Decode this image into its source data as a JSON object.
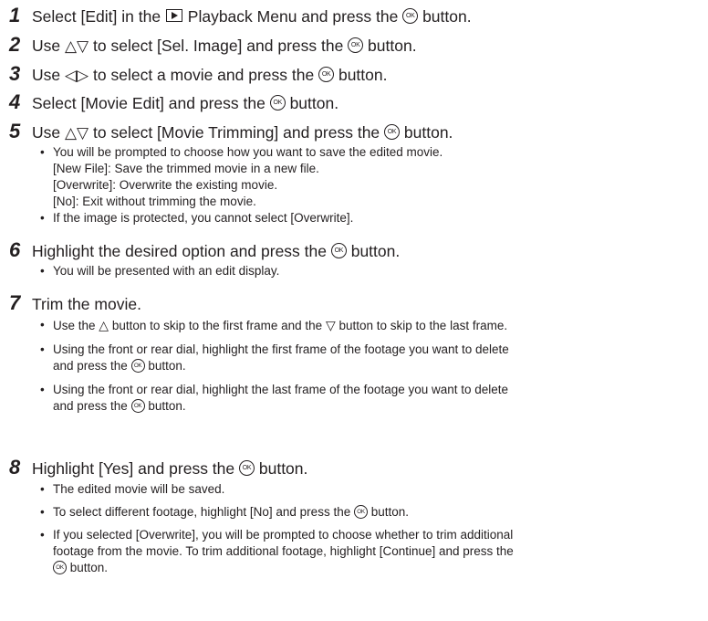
{
  "steps": [
    {
      "num": "1",
      "parts": [
        "Select [Edit] in the ",
        " Playback Menu and press the ",
        " button."
      ],
      "icons": [
        "playback-icon",
        "ok-button-icon"
      ]
    },
    {
      "num": "2",
      "parts": [
        "Use ",
        " to select [Sel. Image] and press the ",
        " button."
      ],
      "arrows": "△▽",
      "icons": [
        "ok-button-icon"
      ]
    },
    {
      "num": "3",
      "parts": [
        "Use ",
        " to select a movie and press the ",
        " button."
      ],
      "arrows": "◁▷",
      "icons": [
        "ok-button-icon"
      ]
    },
    {
      "num": "4",
      "parts": [
        "Select [Movie Edit] and press the ",
        " button."
      ],
      "icons": [
        "ok-button-icon"
      ]
    },
    {
      "num": "5",
      "parts": [
        "Use ",
        " to select [Movie Trimming] and press the ",
        " button."
      ],
      "arrows": "△▽",
      "icons": [
        "ok-button-icon"
      ],
      "bullets": [
        {
          "lines": [
            "You will be prompted to choose how you want to save the edited movie.",
            "[New File]: Save the trimmed movie in a new file.",
            "[Overwrite]: Overwrite the existing movie.",
            "[No]: Exit without trimming the movie."
          ]
        },
        {
          "lines": [
            "If the image is protected, you cannot select [Overwrite]."
          ]
        }
      ]
    },
    {
      "num": "6",
      "parts": [
        "Highlight the desired option and press the ",
        " button."
      ],
      "icons": [
        "ok-button-icon"
      ],
      "bullets": [
        {
          "lines": [
            "You will be presented with an edit display."
          ]
        }
      ]
    },
    {
      "num": "7",
      "parts": [
        "Trim the movie."
      ],
      "bullets": [
        {
          "parts": [
            "Use the ",
            " button to skip to the first frame and the ",
            " button to skip to the last frame."
          ],
          "up_arrow": "△",
          "down_arrow": "▽"
        },
        {
          "line1": "Using the front or rear dial, highlight the first frame of the footage you want to delete",
          "line2_parts": [
            "and press the ",
            " button."
          ]
        },
        {
          "line1": "Using the front or rear dial, highlight the last frame of the footage you want to delete",
          "line2_parts": [
            "and press the ",
            " button."
          ]
        }
      ]
    },
    {
      "num": "8",
      "parts": [
        "Highlight [Yes] and press the ",
        " button."
      ],
      "icons": [
        "ok-button-icon"
      ],
      "bullets": [
        {
          "lines": [
            "The edited movie will be saved."
          ]
        },
        {
          "parts": [
            "To select different footage, highlight [No] and press the ",
            " button."
          ]
        },
        {
          "line1": "If you selected [Overwrite], you will be prompted to choose whether to trim additional",
          "line2": "footage from the movie. To trim additional footage, highlight [Continue] and press the",
          "line3_parts": [
            "",
            " button."
          ]
        }
      ]
    }
  ],
  "ok_label": "OK",
  "bullet_char": "•"
}
